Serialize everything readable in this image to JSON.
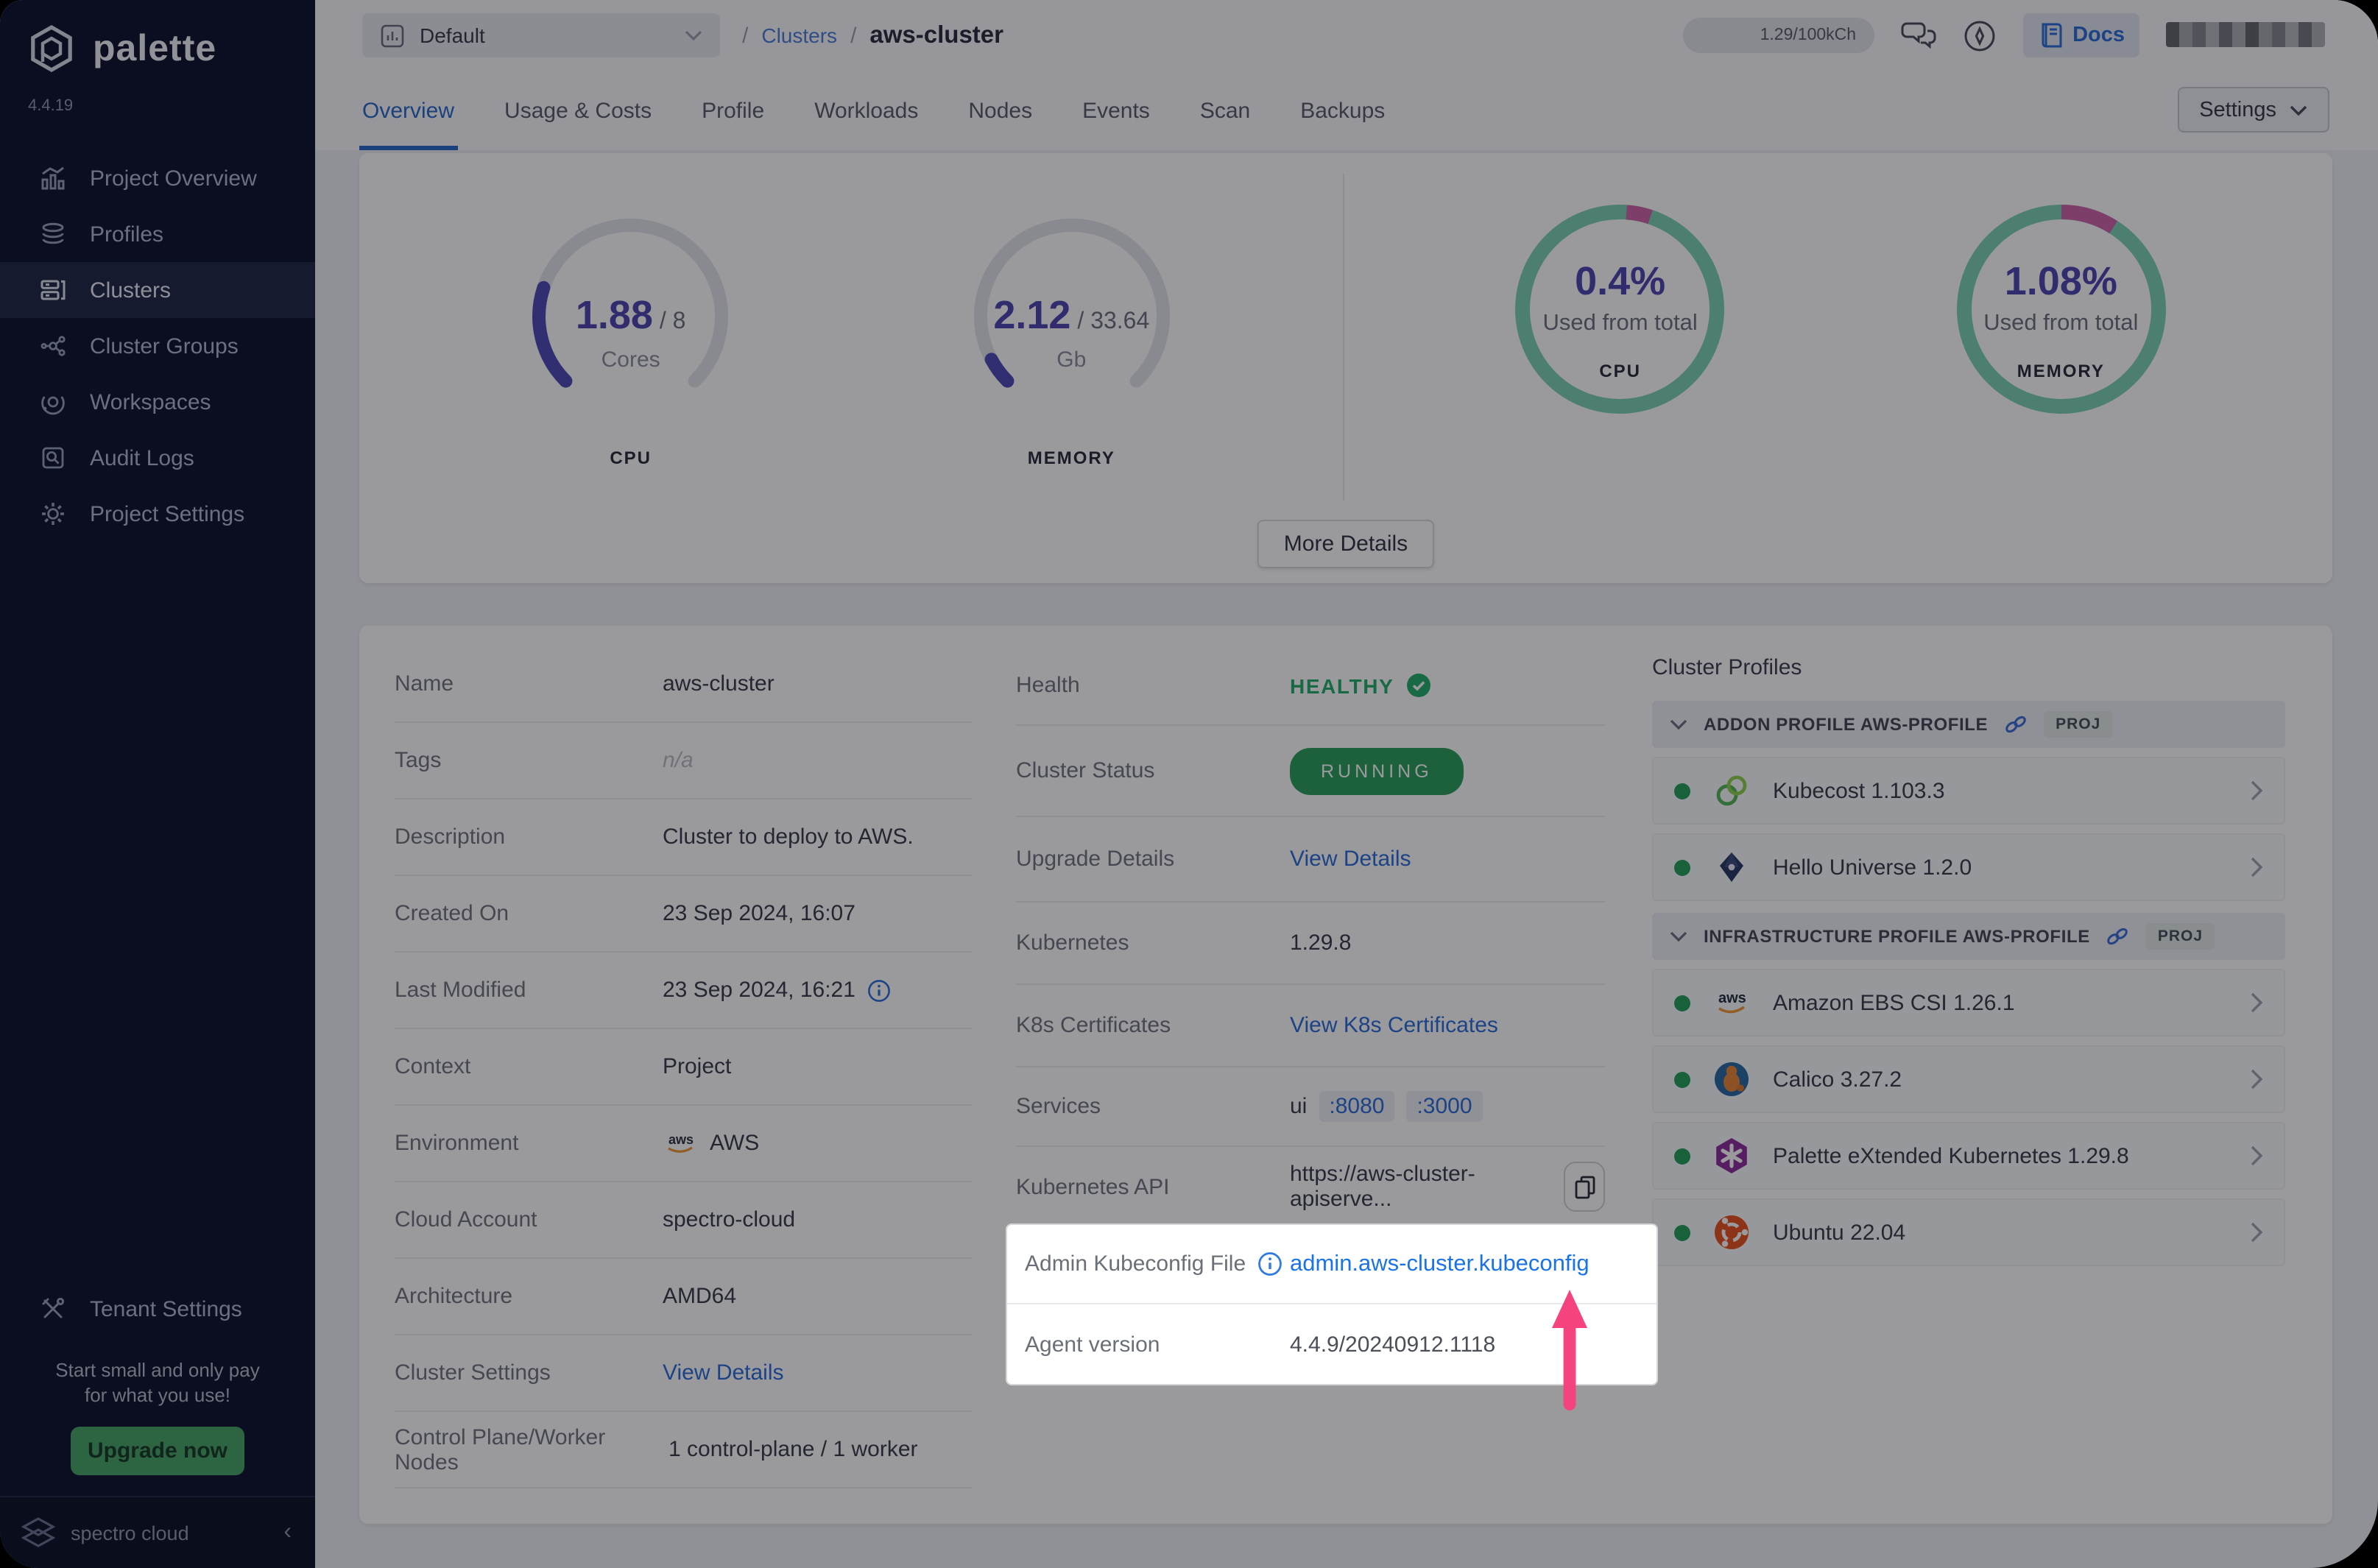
{
  "app": {
    "brand": "palette",
    "version": "4.4.19",
    "footer_brand": "spectro cloud"
  },
  "sidebar": {
    "items": [
      {
        "label": "Project Overview"
      },
      {
        "label": "Profiles"
      },
      {
        "label": "Clusters"
      },
      {
        "label": "Cluster Groups"
      },
      {
        "label": "Workspaces"
      },
      {
        "label": "Audit Logs"
      },
      {
        "label": "Project Settings"
      }
    ],
    "tenant": {
      "label": "Tenant Settings"
    },
    "promo": {
      "line1": "Start small and only pay",
      "line2": "for what you use!",
      "cta": "Upgrade now"
    }
  },
  "topbar": {
    "project": "Default",
    "breadcrumb": {
      "sep": "/",
      "section": "Clusters",
      "current": "aws-cluster"
    },
    "credits": "1.29/100kCh",
    "docs": "Docs"
  },
  "tabs": {
    "items": [
      {
        "label": "Overview"
      },
      {
        "label": "Usage & Costs"
      },
      {
        "label": "Profile"
      },
      {
        "label": "Workloads"
      },
      {
        "label": "Nodes"
      },
      {
        "label": "Events"
      },
      {
        "label": "Scan"
      },
      {
        "label": "Backups"
      }
    ],
    "settings": "Settings"
  },
  "overview": {
    "cpu_gauge": {
      "used": "1.88",
      "sep": "/",
      "total": "8",
      "unit": "Cores",
      "caption": "CPU",
      "fraction": 0.235
    },
    "memory_gauge": {
      "used": "2.12",
      "sep": "/",
      "total": "33.64",
      "unit": "Gb",
      "caption": "MEMORY",
      "fraction": 0.063
    },
    "cpu_donut": {
      "value": "0.4%",
      "label": "Used from total",
      "caption": "CPU"
    },
    "memory_donut": {
      "value": "1.08%",
      "label": "Used from total",
      "caption": "MEMORY"
    },
    "more_details": "More Details"
  },
  "details": {
    "left": [
      {
        "label": "Name",
        "value": "aws-cluster"
      },
      {
        "label": "Tags",
        "value": "n/a"
      },
      {
        "label": "Description",
        "value": "Cluster to deploy to AWS."
      },
      {
        "label": "Created On",
        "value": "23 Sep 2024, 16:07"
      },
      {
        "label": "Last Modified",
        "value": "23 Sep 2024, 16:21"
      },
      {
        "label": "Context",
        "value": "Project"
      },
      {
        "label": "Environment",
        "value": "AWS"
      },
      {
        "label": "Cloud Account",
        "value": "spectro-cloud"
      },
      {
        "label": "Architecture",
        "value": "AMD64"
      },
      {
        "label": "Cluster Settings",
        "value": "View Details"
      },
      {
        "label": "Control Plane/Worker Nodes",
        "value": "1 control-plane / 1 worker"
      }
    ],
    "mid": {
      "health_label": "Health",
      "health_value": "HEALTHY",
      "status_label": "Cluster Status",
      "status_value": "RUNNING",
      "upgrade_label": "Upgrade Details",
      "upgrade_value": "View Details",
      "k8s_label": "Kubernetes",
      "k8s_value": "1.29.8",
      "certs_label": "K8s Certificates",
      "certs_value": "View K8s Certificates",
      "services_label": "Services",
      "services_value": "ui",
      "services_ports": [
        ":8080",
        ":3000"
      ],
      "api_label": "Kubernetes API",
      "api_value": "https://aws-cluster-apiserve..."
    },
    "spotlight": {
      "kubeconfig_label": "Admin Kubeconfig File",
      "kubeconfig_value": "admin.aws-cluster.kubeconfig",
      "agent_label": "Agent version",
      "agent_value": "4.4.9/20240912.1118"
    }
  },
  "profiles": {
    "title": "Cluster Profiles",
    "groups": [
      {
        "name": "ADDON PROFILE AWS-PROFILE",
        "badge": "PROJ",
        "items": [
          {
            "name": "Kubecost 1.103.3"
          },
          {
            "name": "Hello Universe 1.2.0"
          }
        ]
      },
      {
        "name": "INFRASTRUCTURE PROFILE AWS-PROFILE",
        "badge": "PROJ",
        "items": [
          {
            "name": "Amazon EBS CSI 1.26.1"
          },
          {
            "name": "Calico 3.27.2"
          },
          {
            "name": "Palette eXtended Kubernetes 1.29.8"
          },
          {
            "name": "Ubuntu 22.04"
          }
        ]
      }
    ]
  },
  "colors": {
    "accent_blue": "#2e6fd8",
    "indigo": "#4f48b0",
    "teal": "#7fd2b4",
    "pink": "#cf66a8",
    "green": "#27b06c",
    "running_green": "#2da15e",
    "arrow_pink": "#f5437e",
    "sidebar_bg": "#121730",
    "upgrade_green": "#4aa568",
    "fab_purple": "#5a4fb2"
  }
}
